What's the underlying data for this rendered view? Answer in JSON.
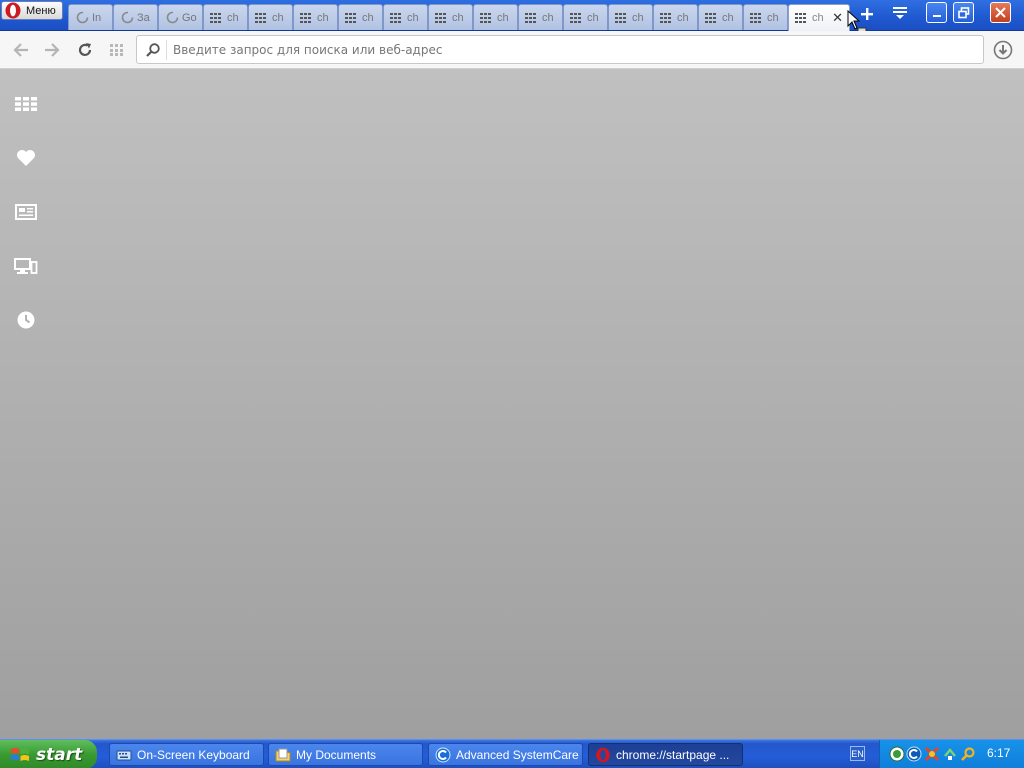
{
  "browser": {
    "menu_label": "Меню",
    "tabs": [
      {
        "title": "In",
        "icon": "loading-icon"
      },
      {
        "title": "За",
        "icon": "loading-icon"
      },
      {
        "title": "Go",
        "icon": "loading-icon"
      },
      {
        "title": "ch",
        "icon": "speed-dial-icon"
      },
      {
        "title": "ch",
        "icon": "speed-dial-icon"
      },
      {
        "title": "ch",
        "icon": "speed-dial-icon"
      },
      {
        "title": "ch",
        "icon": "speed-dial-icon"
      },
      {
        "title": "ch",
        "icon": "speed-dial-icon"
      },
      {
        "title": "ch",
        "icon": "speed-dial-icon"
      },
      {
        "title": "ch",
        "icon": "speed-dial-icon"
      },
      {
        "title": "ch",
        "icon": "speed-dial-icon"
      },
      {
        "title": "ch",
        "icon": "speed-dial-icon"
      },
      {
        "title": "ch",
        "icon": "speed-dial-icon"
      },
      {
        "title": "ch",
        "icon": "speed-dial-icon"
      },
      {
        "title": "ch",
        "icon": "speed-dial-icon"
      },
      {
        "title": "ch",
        "icon": "speed-dial-icon",
        "active": true
      }
    ],
    "address": {
      "placeholder": "Введите запрос для поиска или веб-адрес",
      "value": ""
    },
    "sidebar_icons": [
      "speed-dial-icon",
      "heart-icon",
      "news-icon",
      "devices-icon",
      "history-icon"
    ]
  },
  "taskbar": {
    "start_label": "start",
    "tasks": [
      {
        "label": "On-Screen Keyboard",
        "icon": "keyboard-icon"
      },
      {
        "label": "My Documents",
        "icon": "folder-icon"
      },
      {
        "label": "Advanced SystemCare",
        "icon": "systemcare-icon"
      },
      {
        "label": "chrome://startpage ...",
        "icon": "opera-icon",
        "active": true
      }
    ],
    "language": "EN",
    "clock": "6:17"
  },
  "colors": {
    "titlebar": "#1f58d0",
    "opera_red": "#cc1a22",
    "taskbar": "#245dd8",
    "start_green": "#3a9a32",
    "tray": "#0f7ed9"
  }
}
